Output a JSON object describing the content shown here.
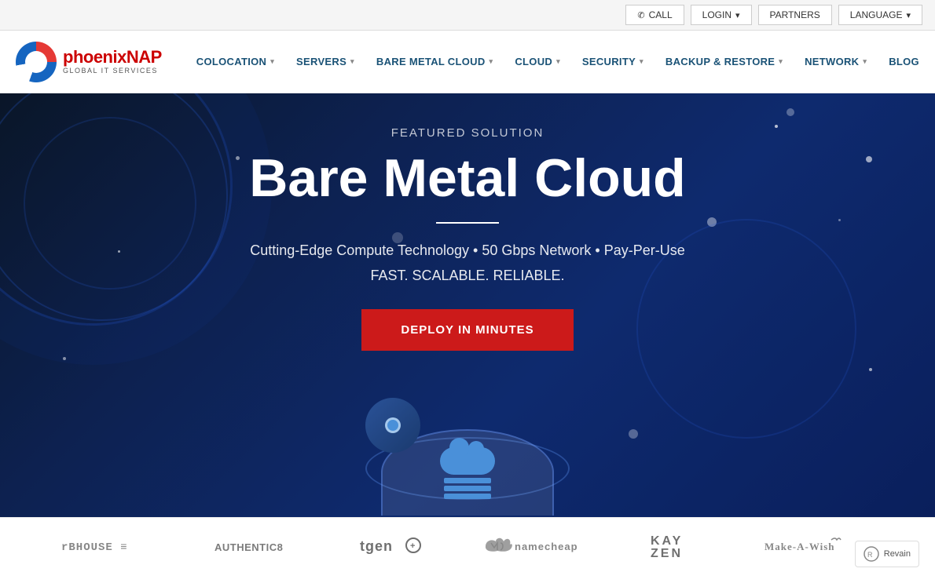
{
  "topBar": {
    "callBtn": "CALL",
    "loginBtn": "LOGIN",
    "partnersBtn": "PARTNERS",
    "languageBtn": "LANGUAGE"
  },
  "nav": {
    "logoTextPart1": "phoenix",
    "logoTextPart2": "NAP",
    "logoSub": "GLOBAL IT SERVICES",
    "items": [
      {
        "label": "COLOCATION",
        "hasDropdown": true
      },
      {
        "label": "SERVERS",
        "hasDropdown": true
      },
      {
        "label": "BARE METAL CLOUD",
        "hasDropdown": true
      },
      {
        "label": "CLOUD",
        "hasDropdown": true
      },
      {
        "label": "SECURITY",
        "hasDropdown": true
      },
      {
        "label": "BACKUP & RESTORE",
        "hasDropdown": true
      },
      {
        "label": "NETWORK",
        "hasDropdown": true
      },
      {
        "label": "BLOG",
        "hasDropdown": false
      }
    ]
  },
  "hero": {
    "featuredLabel": "FEATURED SOLUTION",
    "title": "Bare Metal Cloud",
    "subtitle1": "Cutting-Edge Compute Technology • 50 Gbps Network • Pay-Per-Use",
    "subtitle2": "FAST. SCALABLE. RELIABLE.",
    "ctaLabel": "DEPLOY IN MINUTES"
  },
  "partners": [
    {
      "id": "rbhouse",
      "name": "rBHOUSE ≡"
    },
    {
      "id": "authentic8",
      "name": "AUTHENTIC8"
    },
    {
      "id": "tgen",
      "name": "tgen⊕"
    },
    {
      "id": "namecheap",
      "name": "𝒩 namecheap"
    },
    {
      "id": "kayzen",
      "name": "KAY\nZEN"
    },
    {
      "id": "makewish",
      "name": "Make-A-Wish"
    }
  ],
  "revain": {
    "label": "Revain"
  }
}
